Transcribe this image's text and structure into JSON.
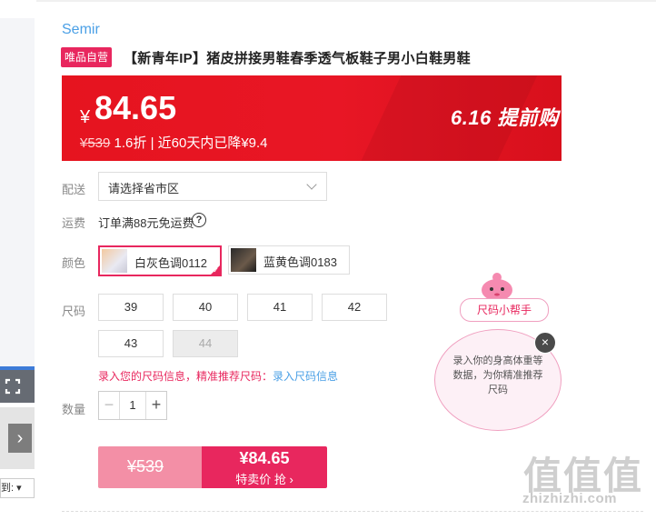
{
  "product": {
    "brand": "Semir",
    "tag": "唯品自营",
    "title": "【新青年IP】猪皮拼接男鞋春季透气板鞋子男小白鞋男鞋"
  },
  "price": {
    "currency": "¥",
    "current": "84.65",
    "original": "¥539",
    "discount_text": "1.6折 | 近60天内已降¥9.4",
    "promo": "6.16 提前购"
  },
  "shipping": {
    "label": "配送",
    "region_placeholder": "请选择省市区",
    "fee_label": "运费",
    "fee_text": "订单满88元免运费",
    "help_glyph": "?"
  },
  "colors": {
    "label": "颜色",
    "options": [
      {
        "name": "白灰色调0112",
        "selected": true
      },
      {
        "name": "蓝黄色调0183",
        "selected": false
      }
    ]
  },
  "sizes": {
    "label": "尺码",
    "options": [
      "39",
      "40",
      "41",
      "42",
      "43",
      "44"
    ],
    "disabled": [
      "44"
    ],
    "info_prompt": "录入您的尺码信息，精准推荐尺码：",
    "info_link": "录入尺码信息"
  },
  "quantity": {
    "label": "数量",
    "value": "1",
    "minus": "−",
    "plus": "+"
  },
  "buy": {
    "original": "¥539",
    "price": "¥84.65",
    "action": "特卖价 抢 ›"
  },
  "helper": {
    "title": "尺码小帮手",
    "bubble_text": "录入你的身高体重等数据，为你精准推荐尺码",
    "close": "×"
  },
  "left_panel": {
    "sort_label": "到: ▾",
    "arrow": "›"
  },
  "watermark": {
    "glyphs": "值值值",
    "url": "zhizhizhi.com"
  },
  "colors_theme": {
    "accent": "#e8275e",
    "banner_red": "#e6141f",
    "link_blue": "#4ba0e6"
  }
}
